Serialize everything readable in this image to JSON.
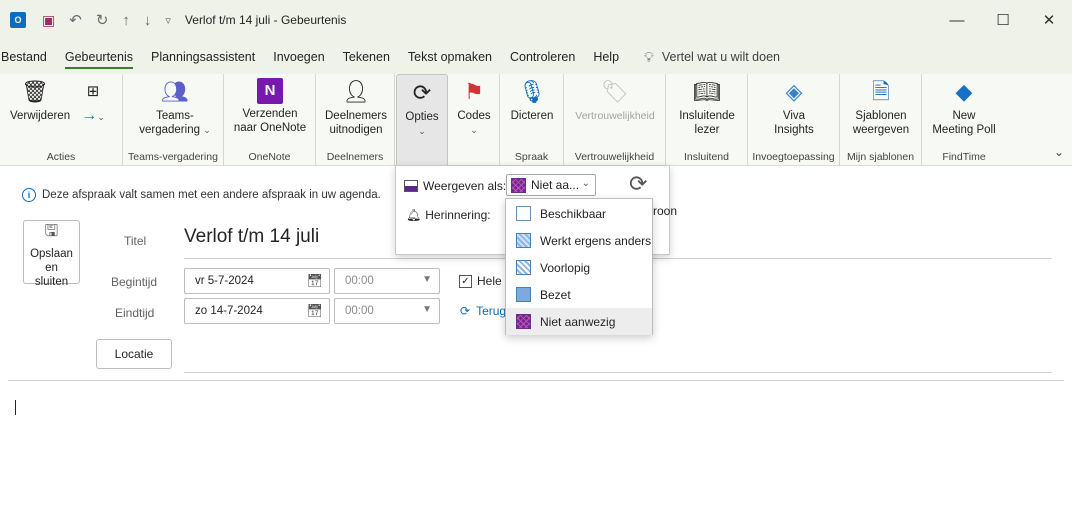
{
  "titlebar": {
    "title": "Verlof t/m 14 juli  -  Gebeurtenis",
    "app_icon": "O",
    "minimize": "—",
    "maximize": "☐",
    "close": "✕"
  },
  "tabs": [
    "Bestand",
    "Gebeurtenis",
    "Planningsassistent",
    "Invoegen",
    "Tekenen",
    "Tekst opmaken",
    "Controleren",
    "Help"
  ],
  "active_tab": "Gebeurtenis",
  "tellme": "Vertel wat u wilt doen",
  "ribbon": {
    "delete": "Verwijderen",
    "teams1": "Teams-",
    "teams2": "vergadering",
    "onenote1": "Verzenden",
    "onenote2": "naar OneNote",
    "invite1": "Deelnemers",
    "invite2": "uitnodigen",
    "options": "Opties",
    "codes": "Codes",
    "dictate": "Dicteren",
    "sensitivity": "Vertrouwelijkheid",
    "reader1": "Insluitende",
    "reader2": "lezer",
    "viva1": "Viva",
    "viva2": "Insights",
    "templates1": "Sjablonen",
    "templates2": "weergeven",
    "poll1": "New",
    "poll2": "Meeting Poll",
    "groups": {
      "acties": "Acties",
      "teams": "Teams-vergadering",
      "onenote": "OneNote",
      "deelnemers": "Deelnemers",
      "spraak": "Spraak",
      "vertrouwelijkheid": "Vertrouwelijkheid",
      "insluitend": "Insluitend",
      "invoeg": "Invoegtoepassing",
      "sjablonen": "Mijn sjablonen",
      "findtime": "FindTime"
    }
  },
  "info": "Deze afspraak valt samen met een andere afspraak in uw agenda.",
  "form": {
    "save1": "Opslaan",
    "save2": "en",
    "save3": "sluiten",
    "title_label": "Titel",
    "title_value": "Verlof t/m 14 juli",
    "start_label": "Begintijd",
    "start_date": "vr 5-7-2024",
    "start_time": "00:00",
    "end_label": "Eindtijd",
    "end_date": "zo 14-7-2024",
    "end_time": "00:00",
    "allday": "Hele",
    "recurrence": "Terug",
    "location": "Locatie"
  },
  "options_panel": {
    "show_as_label": "Weergeven als:",
    "show_as_value": "Niet aa...",
    "reminder_label": "Herinnering:",
    "pattern": "atroon"
  },
  "show_as_options": [
    {
      "label": "Beschikbaar",
      "swatch": "sw-free"
    },
    {
      "label": "Werkt ergens anders",
      "swatch": "sw-elsewhere"
    },
    {
      "label": "Voorlopig",
      "swatch": "sw-tentative"
    },
    {
      "label": "Bezet",
      "swatch": "sw-busy"
    },
    {
      "label": "Niet aanwezig",
      "swatch": "sw-oof"
    }
  ],
  "colors": {
    "accent": "#3a7d2c",
    "link": "#0f6cbd",
    "oof": "#6b2e8e"
  }
}
